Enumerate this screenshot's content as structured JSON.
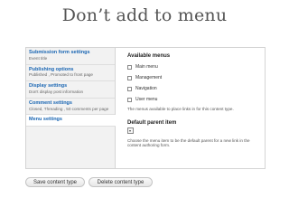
{
  "title": "Don’t add to menu",
  "tabs": [
    {
      "title": "Submission form settings",
      "summary": "Event title"
    },
    {
      "title": "Publishing options",
      "summary": "Published , Promoted to front page"
    },
    {
      "title": "Display settings",
      "summary": "Don't display post information"
    },
    {
      "title": "Comment settings",
      "summary": "Closed, Threading , 50 comments per page"
    },
    {
      "title": "Menu settings",
      "summary": ""
    }
  ],
  "menu_settings": {
    "available_menus_label": "Available menus",
    "menus": [
      {
        "label": "Main menu",
        "checked": false
      },
      {
        "label": "Management",
        "checked": false
      },
      {
        "label": "Navigation",
        "checked": false
      },
      {
        "label": "User menu",
        "checked": false
      }
    ],
    "available_menus_description": "The menus available to place links in for this content type.",
    "default_parent_label": "Default parent item",
    "default_parent_description": "Choose the menu item to be the default parent for a new link in the content authoring form."
  },
  "buttons": {
    "save": "Save content type",
    "delete": "Delete content type"
  }
}
